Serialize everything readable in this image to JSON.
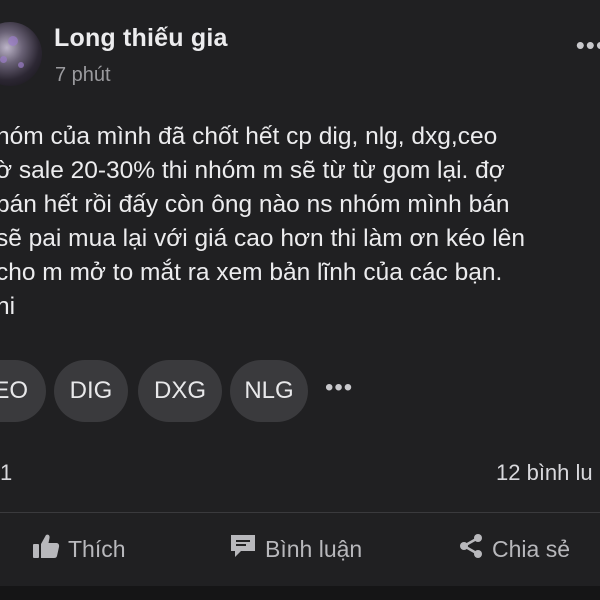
{
  "post": {
    "author": "Long thiếu gia",
    "time": "7 phút",
    "body_lines": [
      "hóm của mình đã chốt hết cp dig, nlg, dxg,ceo",
      "ờ sale 20-30% thi nhóm m sẽ từ từ gom lại.  đợ",
      "bán hết rồi đấy còn ông nào ns nhóm mình bán",
      " sẽ pai mua lại với giá cao hơn thi làm ơn kéo lên",
      "cho m mở to mắt ra xem bản lĩnh của các bạn.",
      "ni"
    ],
    "tags": [
      "EO",
      "DIG",
      "DXG",
      "NLG"
    ],
    "tags_more": "•••",
    "more_menu": "•••",
    "reaction_count": "1",
    "comment_count": "12 bình lu"
  },
  "actions": {
    "like_label": "Thích",
    "comment_label": "Bình luận",
    "share_label": "Chia sẻ"
  },
  "icons": {
    "like": "thumbs-up-icon",
    "comment": "speech-bubble-icon",
    "share": "share-icon",
    "more": "more-dots-icon"
  },
  "colors": {
    "background": "#202022",
    "text": "#ececee",
    "secondary_text": "#9a9a9e",
    "tag_bg": "#3a3a3d"
  }
}
